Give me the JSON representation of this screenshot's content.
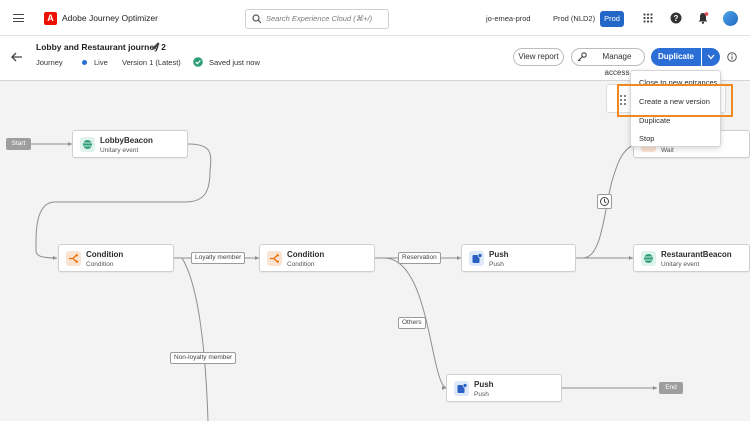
{
  "app": {
    "title": "Adobe Journey Optimizer",
    "logo_letter": "A"
  },
  "topbar": {
    "search_placeholder": "Search Experience Cloud (⌘+/)",
    "org": "jo-emea-prod",
    "sandbox": "Prod (NLD2)",
    "sandbox_badge": "Prod"
  },
  "journey": {
    "title": "Lobby and Restaurant journey 2",
    "type": "Journey",
    "status": "Live",
    "version": "Version 1 (Latest)",
    "saved": "Saved just now"
  },
  "actions": {
    "view_report": "View report",
    "manage_access": "Manage access",
    "duplicate": "Duplicate"
  },
  "dropdown": {
    "items": [
      "Close to new entrances",
      "Create a new version",
      "Duplicate",
      "Stop"
    ],
    "highlighted_index": 1
  },
  "canvas": {
    "start": "Start",
    "end": "End",
    "nodes": [
      {
        "title": "LobbyBeacon",
        "subtitle": "Unitary event"
      },
      {
        "title": "Condition",
        "subtitle": "Condition"
      },
      {
        "title": "Condition",
        "subtitle": "Condition"
      },
      {
        "title": "Push",
        "subtitle": "Push"
      },
      {
        "title": "RestaurantBeacon",
        "subtitle": "Unitary event"
      },
      {
        "title": "Push",
        "subtitle": "Push"
      },
      {
        "title": "",
        "subtitle": "Wait"
      }
    ],
    "paths": {
      "loyalty": "Loyalty member",
      "non_loyalty": "Non-loyalty member",
      "reservation": "Reservation",
      "others": "Others"
    }
  },
  "colors": {
    "accent": "#2b6fd6",
    "highlight": "#f08a20",
    "live": "#2b6fd6",
    "saved": "#2d9d78"
  }
}
